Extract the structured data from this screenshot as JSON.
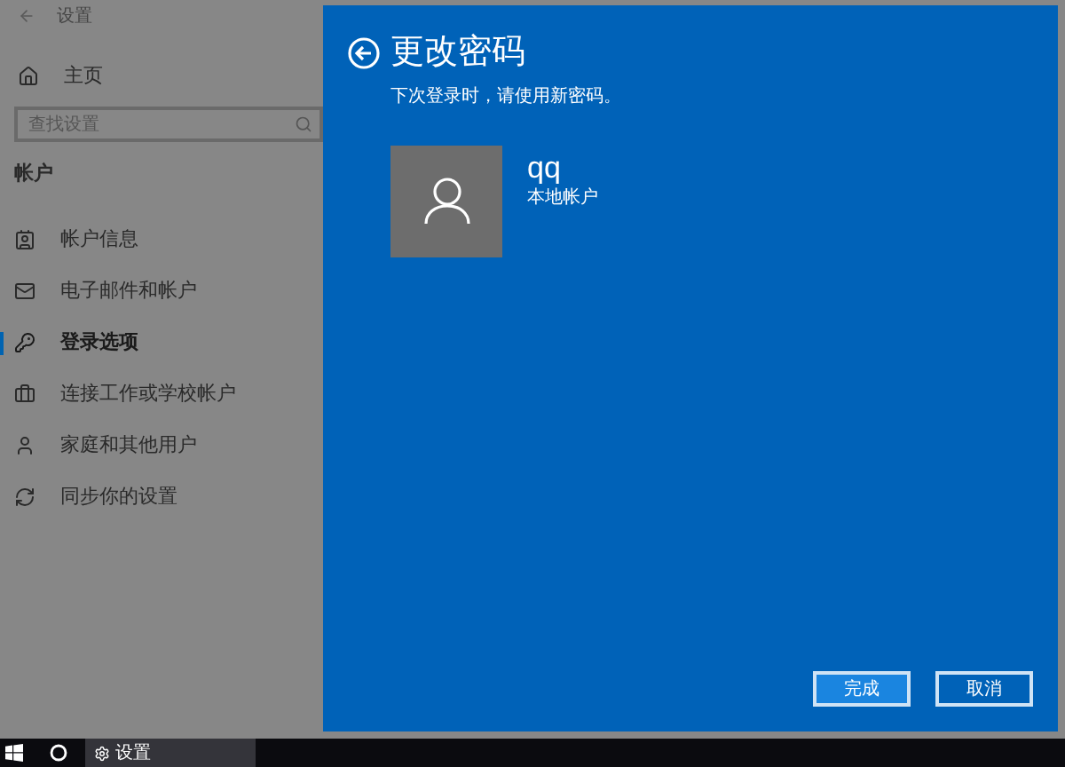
{
  "window": {
    "title": "设置"
  },
  "sidebar": {
    "home": "主页",
    "search": {
      "placeholder": "查找设置"
    },
    "heading": "帐户",
    "items": [
      {
        "label": "帐户信息",
        "selected": false
      },
      {
        "label": "电子邮件和帐户",
        "selected": false
      },
      {
        "label": "登录选项",
        "selected": true
      },
      {
        "label": "连接工作或学校帐户",
        "selected": false
      },
      {
        "label": "家庭和其他用户",
        "selected": false
      },
      {
        "label": "同步你的设置",
        "selected": false
      }
    ]
  },
  "dialog": {
    "title": "更改密码",
    "subtitle": "下次登录时，请使用新密码。",
    "user": {
      "name": "qq",
      "type": "本地帐户"
    },
    "buttons": [
      {
        "label": "完成",
        "focused": true
      },
      {
        "label": "取消",
        "focused": false
      }
    ]
  },
  "taskbar": {
    "app": "设置"
  }
}
